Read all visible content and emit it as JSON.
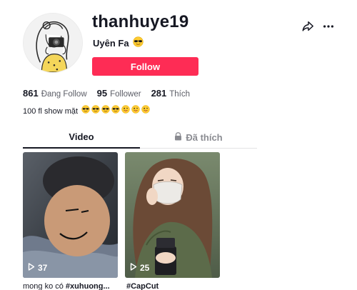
{
  "profile": {
    "username": "thanhuye19",
    "nickname": "Uyên Fa",
    "nickname_emoji": "sunglasses-emoji",
    "follow_label": "Follow",
    "bio_text": "100 fl show mặt",
    "bio_emojis": [
      "sunglasses",
      "sunglasses",
      "sunglasses",
      "sunglasses",
      "tongue",
      "tongue",
      "tongue"
    ]
  },
  "stats": {
    "following_count": "861",
    "following_label": "Đang Follow",
    "followers_count": "95",
    "followers_label": "Follower",
    "likes_count": "281",
    "likes_label": "Thích"
  },
  "tabs": {
    "video": "Video",
    "liked": "Đã thích"
  },
  "videos": [
    {
      "views": "37",
      "caption_text": "mong ko có ",
      "caption_tag": "#xuhuong..."
    },
    {
      "views": "25",
      "caption_text": "",
      "caption_tag": "#CapCut"
    }
  ],
  "colors": {
    "brand": "#fe2c55",
    "text": "#161823",
    "muted": "#8a8b91"
  },
  "icons": [
    "share-icon",
    "more-icon",
    "lock-icon",
    "play-icon"
  ]
}
